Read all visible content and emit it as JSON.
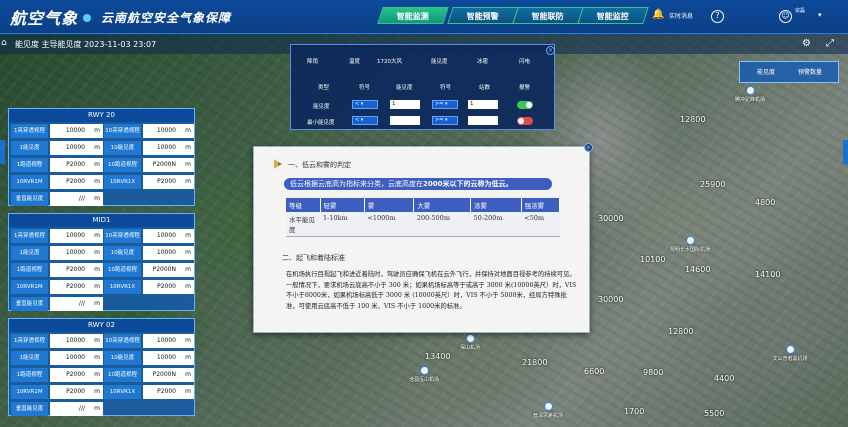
{
  "header": {
    "logo": "航空气象",
    "subtitle": "云南航空安全气象保障",
    "nav": [
      "智能监测",
      "智能预警",
      "智能联防",
      "智能监控"
    ],
    "realtime_label": "实时消息",
    "help": "?",
    "user_name": "宗磊"
  },
  "subbar": {
    "title": "能见度  主导能见度  2023-11-03 23:07"
  },
  "rwys": [
    {
      "name": "RWY 20",
      "rows": [
        {
          "l1": "1亮穿透视程",
          "v1": "10000",
          "u1": "m",
          "l2": "10亮穿透视程",
          "v2": "10000",
          "u2": "m"
        },
        {
          "l1": "1能见度",
          "v1": "10000",
          "u1": "m",
          "l2": "10能见度",
          "v2": "10000",
          "u2": "m"
        },
        {
          "l1": "1跑道视程",
          "v1": "P2000",
          "u1": "m",
          "l2": "10跑道视程",
          "v2": "P2000N",
          "u2": "m"
        },
        {
          "l1": "10RVR1M",
          "v1": "P2000",
          "u1": "m",
          "l2": "10RVR1X",
          "v2": "P2000",
          "u2": "m"
        },
        {
          "l1": "垂直能见度",
          "v1": "///",
          "u1": "m"
        }
      ]
    },
    {
      "name": "MID1",
      "rows": [
        {
          "l1": "1亮穿透视程",
          "v1": "10000",
          "u1": "m",
          "l2": "10亮穿透视程",
          "v2": "10000",
          "u2": "m"
        },
        {
          "l1": "1能见度",
          "v1": "10000",
          "u1": "m",
          "l2": "10能见度",
          "v2": "10000",
          "u2": "m"
        },
        {
          "l1": "1跑道视程",
          "v1": "P2000",
          "u1": "m",
          "l2": "10跑道视程",
          "v2": "P2000N",
          "u2": "m"
        },
        {
          "l1": "10RVR1M",
          "v1": "P2000",
          "u1": "m",
          "l2": "10RVR1X",
          "v2": "P2000",
          "u2": "m"
        },
        {
          "l1": "垂直能见度",
          "v1": "///",
          "u1": "m"
        }
      ]
    },
    {
      "name": "RWY 02",
      "rows": [
        {
          "l1": "1亮穿透视程",
          "v1": "10000",
          "u1": "m",
          "l2": "10亮穿透视程",
          "v2": "10000",
          "u2": "m"
        },
        {
          "l1": "1能见度",
          "v1": "10000",
          "u1": "m",
          "l2": "10能见度",
          "v2": "10000",
          "u2": "m"
        },
        {
          "l1": "1跑道视程",
          "v1": "P2000",
          "u1": "m",
          "l2": "10跑道视程",
          "v2": "P2000N",
          "u2": "m"
        },
        {
          "l1": "10RVR1M",
          "v1": "P2000",
          "u1": "m",
          "l2": "10RVR1X",
          "v2": "P2000",
          "u2": "m"
        },
        {
          "l1": "垂直能见度",
          "v1": "///",
          "u1": "m"
        }
      ]
    }
  ],
  "control": {
    "tabs": [
      "降雨",
      "温度",
      "1720大风",
      "能见度",
      "冰雹",
      "闪电"
    ],
    "headers": [
      "类型",
      "符号",
      "能见度",
      "符号",
      "站数",
      "报警"
    ],
    "rows": [
      {
        "type": "能见度",
        "op1": "<",
        "v1": "1",
        "op2": ">=",
        "v2": "1",
        "alarm": "on"
      },
      {
        "type": "最小能见度",
        "op1": "<",
        "v1": "",
        "op2": ">=",
        "v2": "",
        "alarm": "off"
      }
    ]
  },
  "right_panel": {
    "btn1": "能见度",
    "btn2": "预警数量"
  },
  "modal": {
    "sec1_title": "一、低云和雾的判定",
    "highlight_a": "低云根据云底高为指标来分类，云底高度在",
    "highlight_b": "2000米以下的云称为低云。",
    "table_headers": [
      "等级",
      "轻雾",
      "雾",
      "大雾",
      "浓雾",
      "强浓雾"
    ],
    "table_row": [
      "水平能见度",
      "1-10km",
      "<1000m",
      "200-500m",
      "50-200m",
      "<50m"
    ],
    "sec2_title": "二、起飞和着陆标准",
    "para": "在机场执行目视起飞和进近着陆时，驾驶员应确保飞机在云外飞行，并保持对地面目视参考的持续可见。一般情况下，要求机场云底高不小于 300 米；如果机场标高等于或高于 3000 米(10000英尺）时，VIS 不小于8000米，如果机场标高低于 3000 米 (10000英尺）时，VIS 不小于 5000米，经局方特殊批准，可使用云底高不低于 100 米、VIS 不小于 1600米的标准。"
  },
  "map_labels": [
    "12800",
    "25900",
    "30000",
    "10100",
    "14600",
    "14100",
    "4800",
    "30000",
    "12800",
    "13400",
    "21800",
    "6600",
    "9800",
    "4400",
    "1700",
    "5500",
    "17900",
    "9500"
  ],
  "airports": [
    "昆明长水国际机场",
    "腾冲驼峰机场",
    "沧源佤山机场",
    "文山普者黑机场",
    "普洱思茅机场",
    "保山机场"
  ]
}
